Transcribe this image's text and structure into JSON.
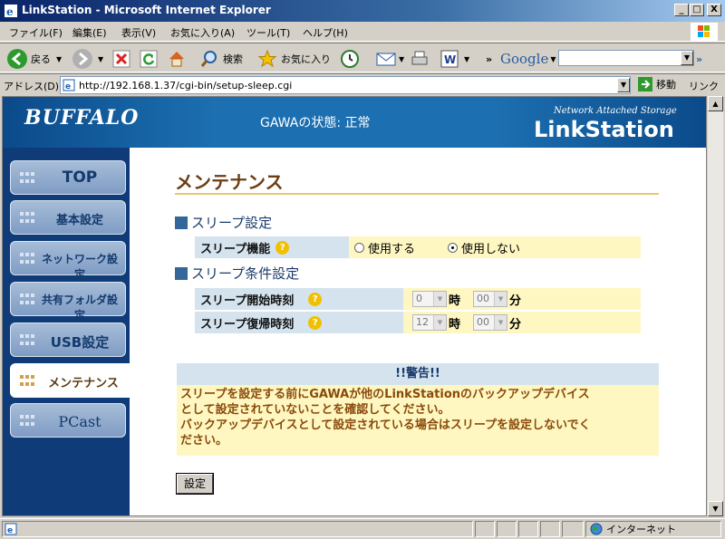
{
  "window": {
    "title": "LinkStation - Microsoft Internet Explorer",
    "controls": {
      "minimize": "_",
      "maximize": "□",
      "close": "X"
    }
  },
  "menu": [
    {
      "label": "ファイル(F)"
    },
    {
      "label": "編集(E)"
    },
    {
      "label": "表示(V)"
    },
    {
      "label": "お気に入り(A)"
    },
    {
      "label": "ツール(T)"
    },
    {
      "label": "ヘルプ(H)"
    }
  ],
  "toolbar": {
    "back_label": "戻る",
    "search_label": "検索",
    "favorites_label": "お気に入り",
    "overflow": "»",
    "google_label": "Google",
    "google_overflow": "»"
  },
  "address": {
    "label": "アドレス(D)",
    "url": "http://192.168.1.37/cgi-bin/setup-sleep.cgi",
    "go_label": "移動",
    "links_label": "リンク"
  },
  "header": {
    "brand": "BUFFALO",
    "status": "GAWAの状態: 正常",
    "tagline": "Network Attached Storage",
    "product": "LinkStation"
  },
  "nav": [
    {
      "label": "TOP"
    },
    {
      "label": "基本設定"
    },
    {
      "label": "ネットワーク設定"
    },
    {
      "label": "共有フォルダ設定"
    },
    {
      "label": "USB設定"
    },
    {
      "label": "メンテナンス"
    },
    {
      "label": "PCast"
    }
  ],
  "colors": {
    "accent": "#0f3c78",
    "title": "#6b3d13",
    "label_bg": "#d4e3ee",
    "value_bg": "#fff7c2"
  },
  "content": {
    "title": "メンテナンス",
    "sleep_section": "スリープ設定",
    "sleep_function_label": "スリープ機能",
    "option_enable": "使用する",
    "option_disable": "使用しない",
    "selected_option": "使用しない",
    "condition_section": "スリープ条件設定",
    "start_label": "スリープ開始時刻",
    "start_hour": "0",
    "start_minute": "00",
    "resume_label": "スリープ復帰時刻",
    "resume_hour": "12",
    "resume_minute": "00",
    "hour_unit": "時",
    "minute_unit": "分",
    "help_glyph": "?",
    "warning_title": "!!警告!!",
    "warning_line1": "スリープを設定する前にGAWAが他のLinkStationのバックアップデバイス",
    "warning_line2": "として設定されていないことを確認してください。",
    "warning_line3": "バックアップデバイスとして設定されている場合はスリープを設定しないでく",
    "warning_line4": "ださい。",
    "submit_label": "設定"
  },
  "statusbar": {
    "zone": "インターネット"
  }
}
